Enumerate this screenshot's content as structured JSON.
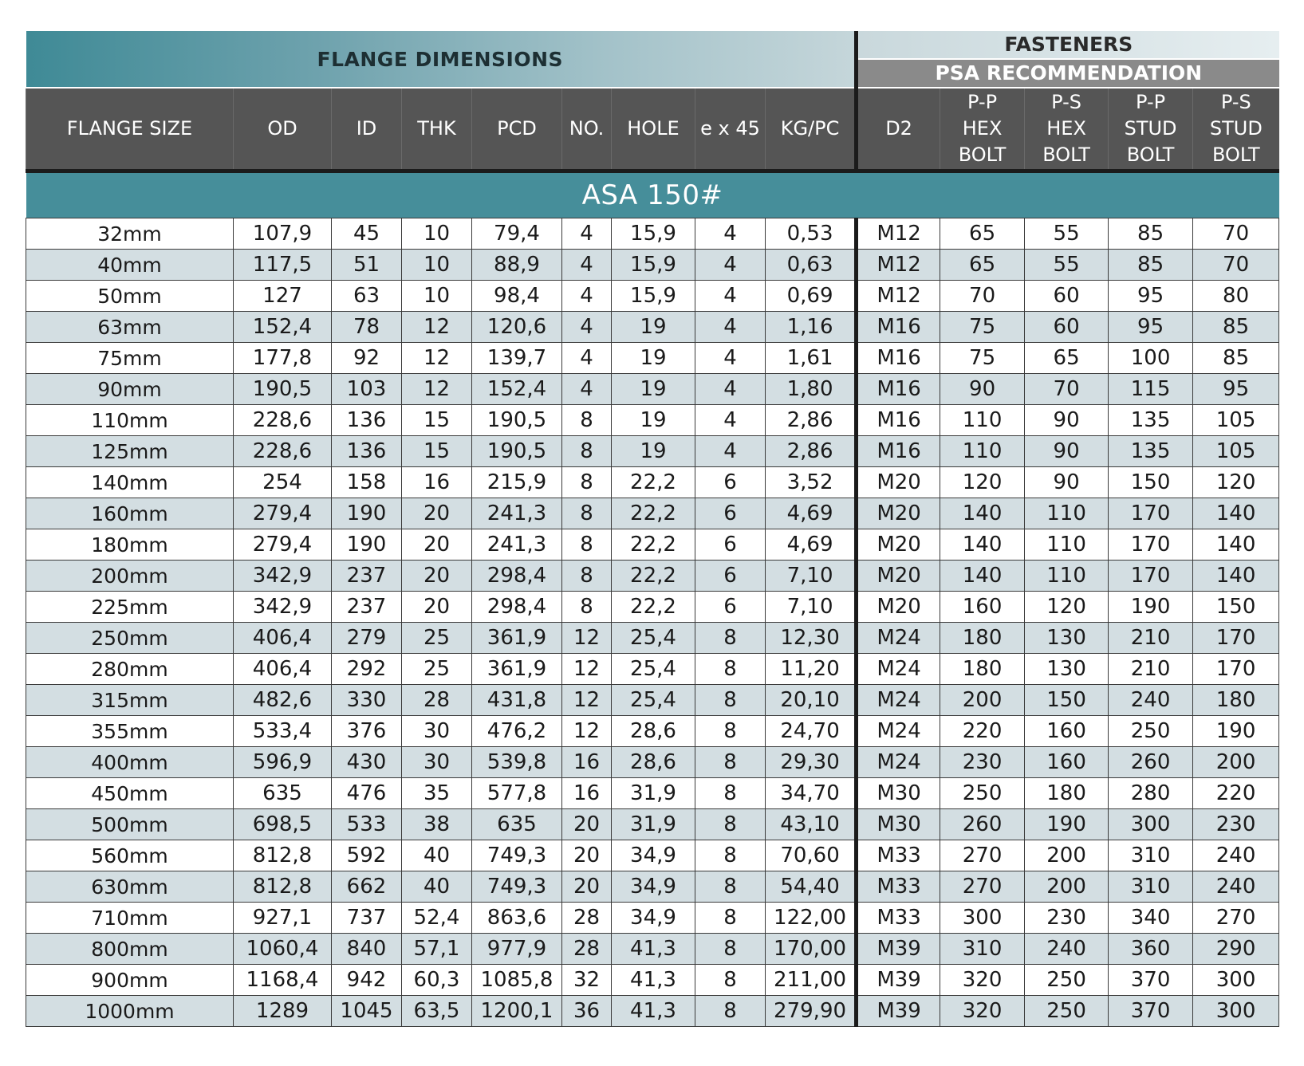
{
  "banner": {
    "flange_dimensions": "FLANGE DIMENSIONS",
    "fasteners": "FASTENERS",
    "psa_recommendation": "PSA RECOMMENDATION"
  },
  "headers": {
    "flange_size": "FLANGE SIZE",
    "od": "OD",
    "id": "ID",
    "thk": "THK",
    "pcd": "PCD",
    "no": "NO.",
    "hole": "HOLE",
    "ex45": "e x 45",
    "kgpc": "KG/PC",
    "d2": "D2",
    "pp_hex_bolt": [
      "P-P",
      "HEX",
      "BOLT"
    ],
    "ps_hex_bolt": [
      "P-S",
      "HEX",
      "BOLT"
    ],
    "pp_stud_bolt": [
      "P-P",
      "STUD",
      "BOLT"
    ],
    "ps_stud_bolt": [
      "P-S",
      "STUD",
      "BOLT"
    ]
  },
  "section": {
    "title": "ASA 150#"
  },
  "rows": [
    [
      "32mm",
      "107,9",
      "45",
      "10",
      "79,4",
      "4",
      "15,9",
      "4",
      "0,53",
      "M12",
      "65",
      "55",
      "85",
      "70"
    ],
    [
      "40mm",
      "117,5",
      "51",
      "10",
      "88,9",
      "4",
      "15,9",
      "4",
      "0,63",
      "M12",
      "65",
      "55",
      "85",
      "70"
    ],
    [
      "50mm",
      "127",
      "63",
      "10",
      "98,4",
      "4",
      "15,9",
      "4",
      "0,69",
      "M12",
      "70",
      "60",
      "95",
      "80"
    ],
    [
      "63mm",
      "152,4",
      "78",
      "12",
      "120,6",
      "4",
      "19",
      "4",
      "1,16",
      "M16",
      "75",
      "60",
      "95",
      "85"
    ],
    [
      "75mm",
      "177,8",
      "92",
      "12",
      "139,7",
      "4",
      "19",
      "4",
      "1,61",
      "M16",
      "75",
      "65",
      "100",
      "85"
    ],
    [
      "90mm",
      "190,5",
      "103",
      "12",
      "152,4",
      "4",
      "19",
      "4",
      "1,80",
      "M16",
      "90",
      "70",
      "115",
      "95"
    ],
    [
      "110mm",
      "228,6",
      "136",
      "15",
      "190,5",
      "8",
      "19",
      "4",
      "2,86",
      "M16",
      "110",
      "90",
      "135",
      "105"
    ],
    [
      "125mm",
      "228,6",
      "136",
      "15",
      "190,5",
      "8",
      "19",
      "4",
      "2,86",
      "M16",
      "110",
      "90",
      "135",
      "105"
    ],
    [
      "140mm",
      "254",
      "158",
      "16",
      "215,9",
      "8",
      "22,2",
      "6",
      "3,52",
      "M20",
      "120",
      "90",
      "150",
      "120"
    ],
    [
      "160mm",
      "279,4",
      "190",
      "20",
      "241,3",
      "8",
      "22,2",
      "6",
      "4,69",
      "M20",
      "140",
      "110",
      "170",
      "140"
    ],
    [
      "180mm",
      "279,4",
      "190",
      "20",
      "241,3",
      "8",
      "22,2",
      "6",
      "4,69",
      "M20",
      "140",
      "110",
      "170",
      "140"
    ],
    [
      "200mm",
      "342,9",
      "237",
      "20",
      "298,4",
      "8",
      "22,2",
      "6",
      "7,10",
      "M20",
      "140",
      "110",
      "170",
      "140"
    ],
    [
      "225mm",
      "342,9",
      "237",
      "20",
      "298,4",
      "8",
      "22,2",
      "6",
      "7,10",
      "M20",
      "160",
      "120",
      "190",
      "150"
    ],
    [
      "250mm",
      "406,4",
      "279",
      "25",
      "361,9",
      "12",
      "25,4",
      "8",
      "12,30",
      "M24",
      "180",
      "130",
      "210",
      "170"
    ],
    [
      "280mm",
      "406,4",
      "292",
      "25",
      "361,9",
      "12",
      "25,4",
      "8",
      "11,20",
      "M24",
      "180",
      "130",
      "210",
      "170"
    ],
    [
      "315mm",
      "482,6",
      "330",
      "28",
      "431,8",
      "12",
      "25,4",
      "8",
      "20,10",
      "M24",
      "200",
      "150",
      "240",
      "180"
    ],
    [
      "355mm",
      "533,4",
      "376",
      "30",
      "476,2",
      "12",
      "28,6",
      "8",
      "24,70",
      "M24",
      "220",
      "160",
      "250",
      "190"
    ],
    [
      "400mm",
      "596,9",
      "430",
      "30",
      "539,8",
      "16",
      "28,6",
      "8",
      "29,30",
      "M24",
      "230",
      "160",
      "260",
      "200"
    ],
    [
      "450mm",
      "635",
      "476",
      "35",
      "577,8",
      "16",
      "31,9",
      "8",
      "34,70",
      "M30",
      "250",
      "180",
      "280",
      "220"
    ],
    [
      "500mm",
      "698,5",
      "533",
      "38",
      "635",
      "20",
      "31,9",
      "8",
      "43,10",
      "M30",
      "260",
      "190",
      "300",
      "230"
    ],
    [
      "560mm",
      "812,8",
      "592",
      "40",
      "749,3",
      "20",
      "34,9",
      "8",
      "70,60",
      "M33",
      "270",
      "200",
      "310",
      "240"
    ],
    [
      "630mm",
      "812,8",
      "662",
      "40",
      "749,3",
      "20",
      "34,9",
      "8",
      "54,40",
      "M33",
      "270",
      "200",
      "310",
      "240"
    ],
    [
      "710mm",
      "927,1",
      "737",
      "52,4",
      "863,6",
      "28",
      "34,9",
      "8",
      "122,00",
      "M33",
      "300",
      "230",
      "340",
      "270"
    ],
    [
      "800mm",
      "1060,4",
      "840",
      "57,1",
      "977,9",
      "28",
      "41,3",
      "8",
      "170,00",
      "M39",
      "310",
      "240",
      "360",
      "290"
    ],
    [
      "900mm",
      "1168,4",
      "942",
      "60,3",
      "1085,8",
      "32",
      "41,3",
      "8",
      "211,00",
      "M39",
      "320",
      "250",
      "370",
      "300"
    ],
    [
      "1000mm",
      "1289",
      "1045",
      "63,5",
      "1200,1",
      "36",
      "41,3",
      "8",
      "279,90",
      "M39",
      "320",
      "250",
      "370",
      "300"
    ]
  ]
}
